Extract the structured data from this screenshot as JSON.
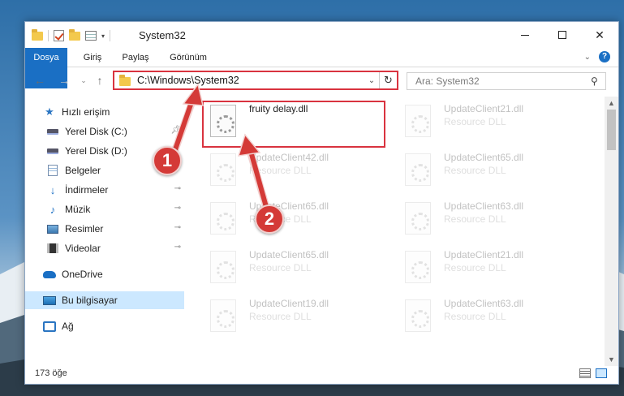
{
  "window": {
    "title": "System32"
  },
  "ribbon": {
    "tabs": [
      {
        "label": "Dosya"
      },
      {
        "label": "Giriş"
      },
      {
        "label": "Paylaş"
      },
      {
        "label": "Görünüm"
      }
    ],
    "accent": "#1a6fc4"
  },
  "navigation": {
    "address": "C:\\Windows\\System32",
    "search_placeholder": "Ara: System32"
  },
  "sidebar": {
    "items": [
      {
        "label": "Hızlı erişim",
        "icon": "star-icon"
      },
      {
        "label": "Yerel Disk (C:)",
        "icon": "disk-icon"
      },
      {
        "label": "Yerel Disk (D:)",
        "icon": "disk-icon"
      },
      {
        "label": "Belgeler",
        "icon": "document-icon"
      },
      {
        "label": "İndirmeler",
        "icon": "download-icon"
      },
      {
        "label": "Müzik",
        "icon": "music-icon"
      },
      {
        "label": "Resimler",
        "icon": "pictures-icon"
      },
      {
        "label": "Videolar",
        "icon": "video-icon"
      },
      {
        "label": "OneDrive",
        "icon": "cloud-icon"
      },
      {
        "label": "Bu bilgisayar",
        "icon": "computer-icon"
      },
      {
        "label": "Ağ",
        "icon": "network-icon"
      }
    ]
  },
  "files": [
    {
      "name": "fruity delay.dll",
      "type": ""
    },
    {
      "name": "UpdateClient21.dll",
      "type": "Resource DLL"
    },
    {
      "name": "UpdateClient42.dll",
      "type": "Resource DLL"
    },
    {
      "name": "UpdateClient65.dll",
      "type": "Resource DLL"
    },
    {
      "name": "UpdateClient65.dll",
      "type": "Resource DLL"
    },
    {
      "name": "UpdateClient63.dll",
      "type": "Resource DLL"
    },
    {
      "name": "UpdateClient65.dll",
      "type": "Resource DLL"
    },
    {
      "name": "UpdateClient21.dll",
      "type": "Resource DLL"
    },
    {
      "name": "UpdateClient19.dll",
      "type": "Resource DLL"
    },
    {
      "name": "UpdateClient63.dll",
      "type": "Resource DLL"
    }
  ],
  "status": {
    "item_count": "173 öğe"
  },
  "callouts": {
    "step1": "1",
    "step2": "2",
    "color": "#d9333f"
  }
}
